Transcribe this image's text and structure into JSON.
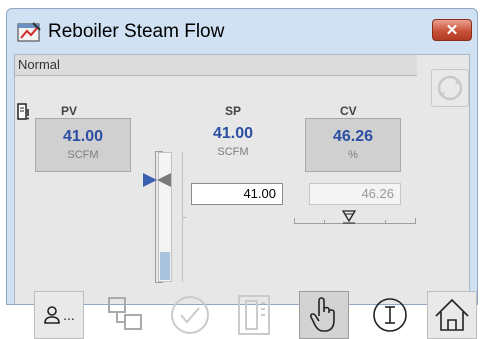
{
  "window": {
    "title": "Reboiler Steam Flow",
    "close_glyph": "✕"
  },
  "status": {
    "mode": "Normal"
  },
  "pv": {
    "label": "PV",
    "value": "41.00",
    "unit": "SCFM"
  },
  "sp": {
    "label": "SP",
    "value": "41.00",
    "unit": "SCFM",
    "entry": "41.00"
  },
  "cv": {
    "label": "CV",
    "value": "46.26",
    "unit": "%",
    "entry": "46.26"
  },
  "bar": {
    "fill_fraction": 0.22
  },
  "toolbar": {
    "operator_ellipsis": "...",
    "icons": [
      "person-icon",
      "trend-link-icon",
      "check-icon",
      "faceplate-doc-icon",
      "hand-icon",
      "info-icon",
      "home-icon"
    ]
  },
  "colors": {
    "value_blue": "#2c4fa3",
    "close_red": "#c9533a",
    "window_frame": "#cfe1f2"
  }
}
